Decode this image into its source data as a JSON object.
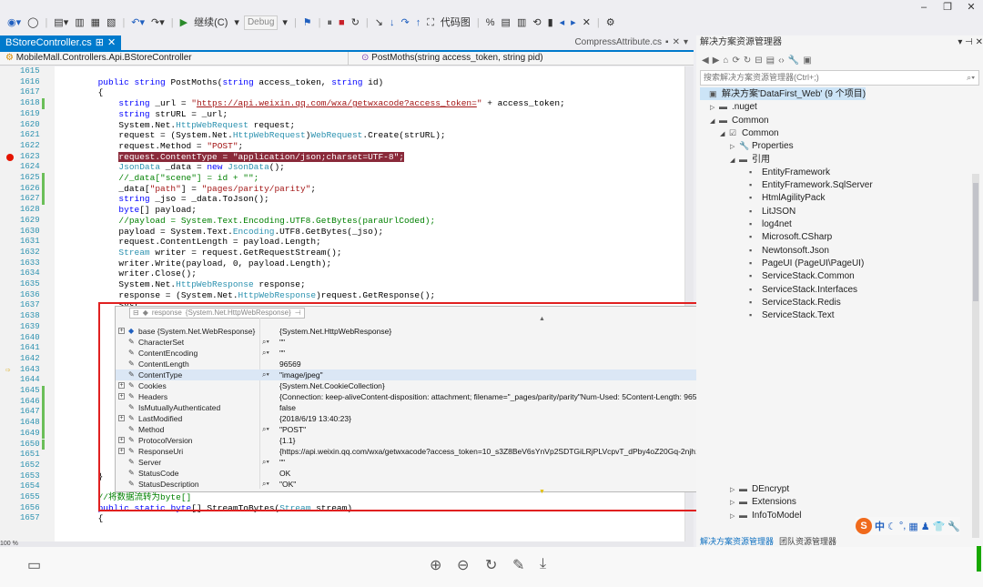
{
  "window_controls": [
    "–",
    "❐",
    "✕"
  ],
  "toolbar": {
    "continue_label": "继续(C)",
    "config": "Debug",
    "code_map": "代码图"
  },
  "tabs": {
    "active": "BStoreController.cs",
    "other": "CompressAttribute.cs"
  },
  "navbar": {
    "left": "MobileMall.Controllers.Api.BStoreController",
    "right": "PostMoths(string access_token, string pid)"
  },
  "editor": {
    "lines": [
      {
        "n": "1615",
        "html": ""
      },
      {
        "n": "1616",
        "html": "        <span class='kw'>public</span> <span class='kw'>string</span> PostMoths(<span class='kw'>string</span> access_token, <span class='kw'>string</span> id)"
      },
      {
        "n": "1617",
        "html": "        {"
      },
      {
        "n": "1618",
        "chg": true,
        "html": "            <span class='kw'>string</span> _url = <span class='str'>\"</span><span class='url'>https://api.weixin.qq.com/wxa/getwxacode?access_token=</span><span class='str'>\"</span> + access_token;"
      },
      {
        "n": "1619",
        "html": "            <span class='kw'>string</span> strURL = _url;"
      },
      {
        "n": "1620",
        "html": "            System.Net.<span class='ty'>HttpWebRequest</span> request;"
      },
      {
        "n": "1621",
        "html": "            request = (System.Net.<span class='ty'>HttpWebRequest</span>)<span class='ty'>WebRequest</span>.Create(strURL);"
      },
      {
        "n": "1622",
        "html": "            request.Method = <span class='str'>\"POST\"</span>;"
      },
      {
        "n": "1623",
        "bp": true,
        "html": "            <span class='hl'>request.ContentType = \"application/json;charset=UTF-8\";</span>"
      },
      {
        "n": "1624",
        "html": "            <span class='ty'>JsonData</span> _data = <span class='kw'>new</span> <span class='ty'>JsonData</span>();"
      },
      {
        "n": "1625",
        "chg": true,
        "html": "            <span class='cmt'>//_data[\"scene\"] = id + \"\";</span>"
      },
      {
        "n": "1626",
        "chg": true,
        "html": "            _data[<span class='str'>\"path\"</span>] = <span class='str'>\"pages/parity/parity\"</span>;"
      },
      {
        "n": "1627",
        "chg": true,
        "html": "            <span class='kw'>string</span> _jso = _data.ToJson();"
      },
      {
        "n": "1628",
        "html": "            <span class='kw'>byte</span>[] payload;"
      },
      {
        "n": "1629",
        "html": "            <span class='cmt'>//payload = System.Text.Encoding.UTF8.GetBytes(paraUrlCoded);</span>"
      },
      {
        "n": "1630",
        "html": "            payload = System.Text.<span class='ty'>Encoding</span>.UTF8.GetBytes(_jso);"
      },
      {
        "n": "1631",
        "html": "            request.ContentLength = payload.Length;"
      },
      {
        "n": "1632",
        "html": "            <span class='ty'>Stream</span> writer = request.GetRequestStream();"
      },
      {
        "n": "1633",
        "html": "            writer.Write(payload, 0, payload.Length);"
      },
      {
        "n": "1634",
        "html": "            writer.Close();"
      },
      {
        "n": "1635",
        "html": "            System.Net.<span class='ty'>HttpWebResponse</span> response;"
      },
      {
        "n": "1636",
        "html": "            response = (System.Net.<span class='ty'>HttpWebResponse</span>)request.GetResponse();"
      },
      {
        "n": "1637",
        "html": "            Syst"
      },
      {
        "n": "1638",
        "html": "            s"
      },
      {
        "n": "1639",
        "html": "            s"
      },
      {
        "n": "1640",
        "html": "            s"
      },
      {
        "n": "1641",
        "html": "            b"
      },
      {
        "n": "1642",
        "html": "            /"
      },
      {
        "n": "1643",
        "ip": true,
        "html": "            v"
      },
      {
        "n": "1644",
        "html": "            /"
      },
      {
        "n": "1645",
        "chg": true,
        "html": ""
      },
      {
        "n": "1646",
        "chg": true,
        "html": "            S"
      },
      {
        "n": "1647",
        "chg": true,
        "html": "            /"
      },
      {
        "n": "1648",
        "chg": true,
        "html": ""
      },
      {
        "n": "1649",
        "chg": true,
        "html": ""
      },
      {
        "n": "1650",
        "chg": true,
        "html": "            S"
      },
      {
        "n": "1651",
        "html": ""
      },
      {
        "n": "1652",
        "html": "            r"
      },
      {
        "n": "1653",
        "html": "        }"
      },
      {
        "n": "1654",
        "html": ""
      },
      {
        "n": "1655",
        "html": "        <span class='cmt'>//将数据流转为byte[]</span>"
      },
      {
        "n": "1656",
        "html": "        <span class='kw'>public</span> <span class='kw'>static</span> <span class='kw'>byte</span>[] StreamToBytes(<span class='ty'>Stream</span> stream)"
      },
      {
        "n": "1657",
        "html": "        {"
      }
    ],
    "zoom": "100 %"
  },
  "datatip": {
    "header_name": "response",
    "header_type": "{System.Net.HttpWebResponse}",
    "rows": [
      {
        "exp": true,
        "icon": "◆",
        "name": "base {System.Net.WebResponse}",
        "mag": false,
        "val": "{System.Net.HttpWebResponse}"
      },
      {
        "exp": false,
        "icon": "🔧",
        "name": "CharacterSet",
        "mag": true,
        "val": "\"\""
      },
      {
        "exp": false,
        "icon": "🔧",
        "name": "ContentEncoding",
        "mag": true,
        "val": "\"\""
      },
      {
        "exp": false,
        "icon": "🔧",
        "name": "ContentLength",
        "mag": false,
        "val": "96569"
      },
      {
        "exp": false,
        "icon": "🔧",
        "name": "ContentType",
        "mag": true,
        "val": "\"image/jpeg\"",
        "sel": true
      },
      {
        "exp": true,
        "icon": "🔧",
        "name": "Cookies",
        "mag": false,
        "val": "{System.Net.CookieCollection}"
      },
      {
        "exp": true,
        "icon": "🔧",
        "name": "Headers",
        "mag": false,
        "val": "{Connection: keep-aliveContent-disposition: attachment; filename=\"_pages/parity/parity\"Num-Used: 5Content-Length: 96569Cache-Control: no-cache, must-revalidateContent-Type: image..."
      },
      {
        "exp": false,
        "icon": "🔧",
        "name": "IsMutuallyAuthenticated",
        "mag": false,
        "val": "false"
      },
      {
        "exp": true,
        "icon": "🔧",
        "name": "LastModified",
        "mag": false,
        "val": "{2018/6/19 13:40:23}"
      },
      {
        "exp": false,
        "icon": "🔧",
        "name": "Method",
        "mag": true,
        "val": "\"POST\""
      },
      {
        "exp": true,
        "icon": "🔧",
        "name": "ProtocolVersion",
        "mag": false,
        "val": "{1.1}"
      },
      {
        "exp": true,
        "icon": "🔧",
        "name": "ResponseUri",
        "mag": false,
        "val": "{https://api.weixin.qq.com/wxa/getwxacode?access_token=10_s3Z8BeV6sYnVp2SDTGiLRjPLVcpvT_dPby4oZ20Gq-2njh1aYudBV6oOnzGl_jYMmKv3VeuV5WCESssLgIEDLMN9NBVb_Y2C22jZqe(..."
      },
      {
        "exp": false,
        "icon": "🔧",
        "name": "Server",
        "mag": true,
        "val": "\"\""
      },
      {
        "exp": false,
        "icon": "🔧",
        "name": "StatusCode",
        "mag": false,
        "val": "OK"
      },
      {
        "exp": false,
        "icon": "🔧",
        "name": "StatusDescription",
        "mag": true,
        "val": "\"OK\""
      }
    ]
  },
  "solution_explorer": {
    "title": "解决方案资源管理器",
    "search_placeholder": "搜索解决方案资源管理器(Ctrl+;)",
    "items": [
      {
        "indent": 0,
        "arrow": "",
        "icon": "▣",
        "label": "解决方案'DataFirst_Web' (9 个项目)",
        "sel": true
      },
      {
        "indent": 1,
        "arrow": "▷",
        "icon": "▬",
        "label": ".nuget"
      },
      {
        "indent": 1,
        "arrow": "◢",
        "icon": "▬",
        "label": "Common"
      },
      {
        "indent": 2,
        "arrow": "◢",
        "icon": "☑",
        "label": "Common"
      },
      {
        "indent": 3,
        "arrow": "▷",
        "icon": "🔧",
        "label": "Properties"
      },
      {
        "indent": 3,
        "arrow": "◢",
        "icon": "▬",
        "label": "引用"
      },
      {
        "indent": 4,
        "arrow": "",
        "icon": "▪",
        "label": "EntityFramework"
      },
      {
        "indent": 4,
        "arrow": "",
        "icon": "▪",
        "label": "EntityFramework.SqlServer"
      },
      {
        "indent": 4,
        "arrow": "",
        "icon": "▪",
        "label": "HtmlAgilityPack"
      },
      {
        "indent": 4,
        "arrow": "",
        "icon": "▪",
        "label": "LitJSON"
      },
      {
        "indent": 4,
        "arrow": "",
        "icon": "▪",
        "label": "log4net"
      },
      {
        "indent": 4,
        "arrow": "",
        "icon": "▪",
        "label": "Microsoft.CSharp"
      },
      {
        "indent": 4,
        "arrow": "",
        "icon": "▪",
        "label": "Newtonsoft.Json"
      },
      {
        "indent": 4,
        "arrow": "",
        "icon": "▪",
        "label": "PageUI (PageUI\\PageUI)"
      },
      {
        "indent": 4,
        "arrow": "",
        "icon": "▪",
        "label": "ServiceStack.Common"
      },
      {
        "indent": 4,
        "arrow": "",
        "icon": "▪",
        "label": "ServiceStack.Interfaces"
      },
      {
        "indent": 4,
        "arrow": "",
        "icon": "▪",
        "label": "ServiceStack.Redis"
      },
      {
        "indent": 4,
        "arrow": "",
        "icon": "▪",
        "label": "ServiceStack.Text"
      }
    ],
    "bottom_items": [
      {
        "indent": 3,
        "arrow": "▷",
        "icon": "▬",
        "label": "DEncrypt"
      },
      {
        "indent": 3,
        "arrow": "▷",
        "icon": "▬",
        "label": "Extensions"
      },
      {
        "indent": 3,
        "arrow": "▷",
        "icon": "▬",
        "label": "InfoToModel"
      }
    ],
    "tab_active": "解决方案资源管理器",
    "tab_other": "团队资源管理器"
  },
  "ime": {
    "logo": "S",
    "label": "中"
  }
}
